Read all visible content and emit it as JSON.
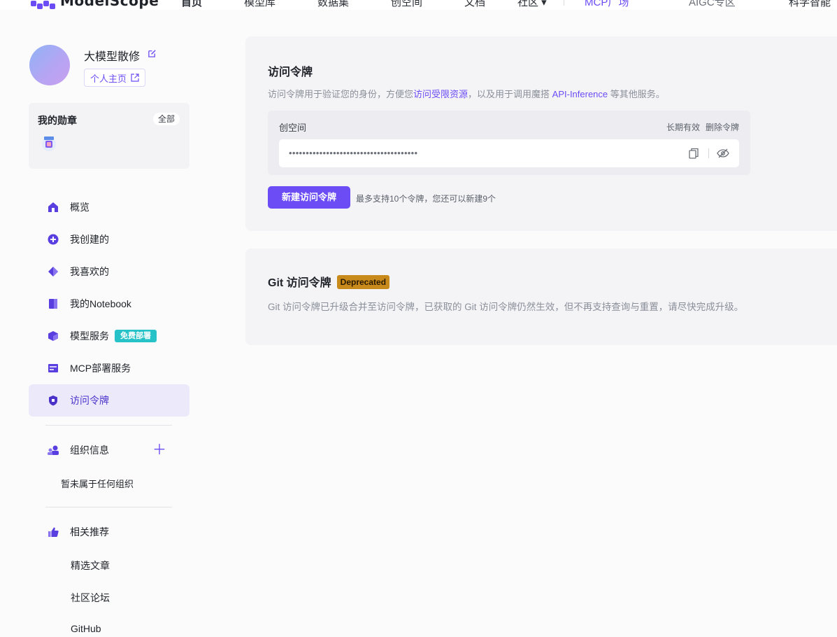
{
  "topnav": {
    "logo_text": "ModelScope",
    "items": [
      "首页",
      "模型库",
      "数据集",
      "创空间",
      "文档",
      "社区 ▾",
      "MCP广场",
      "AIGC专区",
      "科学智能"
    ]
  },
  "profile": {
    "username": "大模型散修",
    "home_label": "个人主页"
  },
  "badges": {
    "title": "我的勋章",
    "all_label": "全部"
  },
  "menu": {
    "overview": "概览",
    "created": "我创建的",
    "liked": "我喜欢的",
    "notebook": "我的Notebook",
    "model_service": "模型服务",
    "free_deploy_tag": "免费部署",
    "mcp_service": "MCP部署服务",
    "access_token": "访问令牌",
    "org_info": "组织信息",
    "org_none": "暂未属于任何组织",
    "recommend": "相关推荐",
    "articles": "精选文章",
    "forum": "社区论坛",
    "github": "GitHub"
  },
  "token_card": {
    "title": "访问令牌",
    "desc_1": "访问令牌用于验证您的身份，方便您",
    "desc_link_1": "访问受限资源",
    "desc_2": "，以及用于调用魔搭 ",
    "desc_link_2": "API-Inference",
    "desc_3": " 等其他服务。",
    "token_name": "创空间",
    "validity": "长期有效",
    "delete_label": "删除令牌",
    "token_mask": "••••••••••••••••••••••••••••••••••••••",
    "new_button": "新建访问令牌",
    "limit_hint": "最多支持10个令牌，您还可以新建9个"
  },
  "git_card": {
    "title": "Git 访问令牌",
    "deprecated_tag": "Deprecated",
    "desc": "Git 访问令牌已升级合并至访问令牌，已获取的 Git 访问令牌仍然生效，但不再支持查询与重置，请尽快完成升级。"
  },
  "colors": {
    "accent": "#6c4cf5",
    "free_tag": "#27c2c8",
    "deprecated": "#c88a1a"
  }
}
